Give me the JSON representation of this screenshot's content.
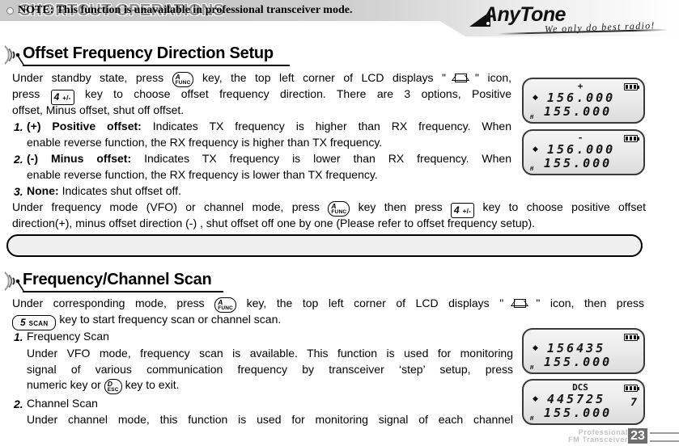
{
  "header": {
    "title": "SHORTCUT OPERATIONS",
    "logo_text": "AnyTone",
    "logo_tagline": "We only do best radio!"
  },
  "keys": {
    "func_top": "A",
    "func_bottom": "FUNC",
    "four_num": "4",
    "four_sub": "+/-",
    "five_num": "5",
    "five_sub": "SCAN",
    "esc_top": "D",
    "esc_bottom": "ESC"
  },
  "section1": {
    "heading": "Offset Frequency Direction Setup",
    "p1_l1a": "Under standby state, press",
    "p1_l1b": "key, the top left corner of LCD displays \"",
    "p1_l1c": "\" icon,",
    "p1_l2a": "press",
    "p1_l2b": "key to choose offset frequency direction. There are 3 options, Positive",
    "p1_l3": "offset, Minus offset, shut off offset.",
    "items": [
      {
        "num": "1.",
        "bold": "(+) Positive offset:",
        "text": "Indicates TX frequency is higher than RX frequency. When",
        "cont": "enable reverse function, the RX frequency is higher than TX frequency."
      },
      {
        "num": "2.",
        "bold": "(-) Minus offset:",
        "text": "Indicates TX frequency is lower than RX frequency. When",
        "cont": "enable reverse function, the RX frequency is lower than TX frequency."
      },
      {
        "num": "3.",
        "bold": "None:",
        "text": "Indicates shut offset off."
      }
    ],
    "p2_l1a": "Under frequency mode (VFO) or channel mode, press",
    "p2_l1b": "key then press",
    "p2_l1c": "key to choose positive offset",
    "p2_l2": "direction(+), minus offset direction (-) , shut offset off one by one (Please refer to offset frequency setup).",
    "note": "NOTE: This function is unavailable in professional transceiver mode."
  },
  "section2": {
    "heading": "Frequency/Channel Scan",
    "p1_l1a": "Under corresponding mode, press",
    "p1_l1b": "key, the top left corner of LCD displays \"",
    "p1_l1c": "\" icon, then press",
    "p1_l2": "key to start frequency scan or channel scan.",
    "items": [
      {
        "num": "1.",
        "title": "Frequency Scan",
        "b1": "Under VFO mode, frequency scan is available. This function is used for monitoring",
        "b2": "signal of various communication frequency by transceiver ‘step’ setup, press",
        "b3a": "numeric key or",
        "b3b": "key to exit."
      },
      {
        "num": "2.",
        "title": "Channel Scan",
        "b1": "Under channel mode, this function is used for monitoring signal of each channel"
      }
    ]
  },
  "lcds": [
    {
      "top_symbol": "+",
      "marker": "◆",
      "line1": "156.000",
      "line2": "155.000",
      "right": "",
      "corner": "H"
    },
    {
      "top_symbol": "-",
      "marker": "◆",
      "line1": "156.000",
      "line2": "155.000",
      "right": "",
      "corner": "H"
    },
    {
      "top_symbol": "",
      "marker": "◆",
      "line1": "156435",
      "line2": "155.000",
      "right": "",
      "corner": "H"
    },
    {
      "top_symbol": "DCS",
      "marker": "◆",
      "line1": "445725",
      "line2": "155.000",
      "right": "7",
      "corner": "H"
    }
  ],
  "footer": {
    "line1": "Professional",
    "line2": "FM Transceiver",
    "page": "23"
  }
}
